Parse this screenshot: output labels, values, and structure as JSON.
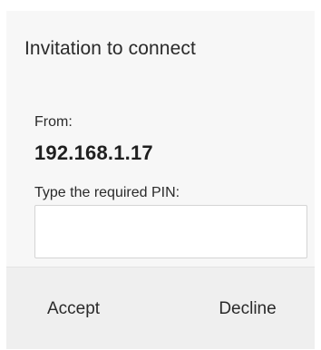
{
  "dialog": {
    "title": "Invitation to connect",
    "from_label": "From:",
    "from_value": "192.168.1.17",
    "pin_label": "Type the required PIN:",
    "pin_value": "",
    "accept_label": "Accept",
    "decline_label": "Decline"
  }
}
